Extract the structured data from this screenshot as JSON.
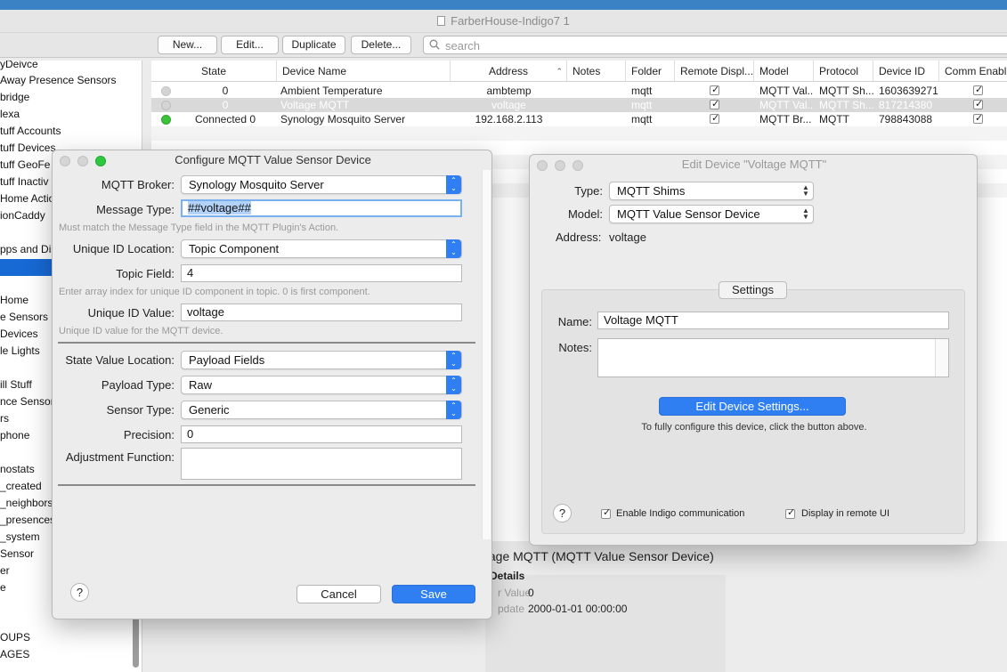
{
  "window": {
    "title": "FarberHouse-Indigo7 1"
  },
  "toolbar": {
    "new_label": "New...",
    "edit_label": "Edit...",
    "duplicate_label": "Duplicate",
    "delete_label": "Delete...",
    "search_placeholder": "search"
  },
  "sidebar": {
    "items": [
      "yDeivce",
      "Away Presence Sensors",
      "bridge",
      "lexa",
      "tuff Accounts",
      "tuff Devices",
      "tuff GeoFe",
      "tuff Inactiv",
      " Home Actio",
      "ionCaddy",
      "pps and Dis",
      "Home",
      "e Sensors",
      "Devices",
      "le Lights",
      "ill Stuff",
      "nce Sensors",
      "rs",
      "phone",
      "nostats",
      "_created",
      "_neighbors",
      "_presences",
      "_system",
      " Sensor",
      "er",
      "e",
      "OUPS",
      "AGES"
    ]
  },
  "table": {
    "columns": [
      "State",
      "Device Name",
      "Address",
      "Notes",
      "Folder",
      "Remote Displ...",
      "Model",
      "Protocol",
      "Device ID",
      "Comm Enabl..."
    ],
    "rows": [
      {
        "status": "gray",
        "state": "0",
        "name": "Ambient Temperature",
        "address": "ambtemp",
        "notes": "",
        "folder": "mqtt",
        "model": "MQTT Val...",
        "protocol": "MQTT Sh...",
        "device_id": "1603639271"
      },
      {
        "status": "gray",
        "state": "0",
        "name": "Voltage MQTT",
        "address": "voltage",
        "notes": "",
        "folder": "mqtt",
        "model": "MQTT Val...",
        "protocol": "MQTT Sh...",
        "device_id": "817214380"
      },
      {
        "status": "green",
        "state": "Connected 0",
        "name": "Synology Mosquito Server",
        "address": "192.168.2.113",
        "notes": "",
        "folder": "mqtt",
        "model": "MQTT Br...",
        "protocol": "MQTT",
        "device_id": "798843088"
      }
    ]
  },
  "detail": {
    "title": "tage MQTT (MQTT Value Sensor Device)",
    "section": "Details",
    "rows": [
      {
        "label": "r Value",
        "value": "0"
      },
      {
        "label": "pdate",
        "value": "2000-01-01 00:00:00"
      }
    ]
  },
  "configure_dialog": {
    "title": "Configure MQTT Value Sensor Device",
    "broker_label": "MQTT Broker:",
    "broker_value": "Synology Mosquito Server",
    "message_type_label": "Message Type:",
    "message_type_value": "##voltage##",
    "message_type_hint": "Must match the Message Type field in the MQTT Plugin's Action.",
    "uid_location_label": "Unique ID Location:",
    "uid_location_value": "Topic Component",
    "topic_field_label": "Topic Field:",
    "topic_field_value": "4",
    "topic_field_hint": "Enter array index for unique ID component in topic.  0 is first component.",
    "uid_value_label": "Unique ID Value:",
    "uid_value_value": "voltage",
    "uid_value_hint": "Unique ID value for the MQTT device.",
    "state_location_label": "State Value Location:",
    "state_location_value": "Payload Fields",
    "payload_type_label": "Payload Type:",
    "payload_type_value": "Raw",
    "sensor_type_label": "Sensor Type:",
    "sensor_type_value": "Generic",
    "precision_label": "Precision:",
    "precision_value": "0",
    "adjustment_label": "Adjustment Function:",
    "adjustment_value": "",
    "cancel_label": "Cancel",
    "save_label": "Save",
    "help_label": "?"
  },
  "edit_dialog": {
    "title": "Edit Device \"Voltage MQTT\"",
    "type_label": "Type:",
    "type_value": "MQTT Shims",
    "model_label": "Model:",
    "model_value": "MQTT Value Sensor Device",
    "address_label": "Address:",
    "address_value": "voltage",
    "settings_tab": "Settings",
    "name_label": "Name:",
    "name_value": "Voltage MQTT",
    "notes_label": "Notes:",
    "notes_value": "",
    "edit_settings_label": "Edit Device Settings...",
    "configure_hint": "To fully configure this device, click the button above.",
    "enable_comm_label": "Enable Indigo communication",
    "display_remote_label": "Display in remote UI",
    "help_label": "?"
  },
  "colors": {
    "accent": "#2f7ff3",
    "selection": "#1769d4",
    "status_green": "#3cc13b",
    "status_gray": "#d2d2d2"
  }
}
